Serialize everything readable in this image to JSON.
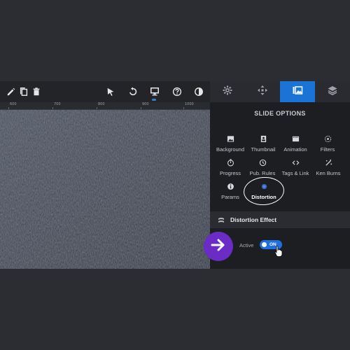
{
  "toolbar": {
    "icons": [
      "pencil-icon",
      "copy-icon",
      "trash-icon",
      "pointer-icon",
      "undo-icon",
      "desktop-icon",
      "help-icon",
      "contrast-icon"
    ]
  },
  "ruler": {
    "labels": [
      "600",
      "700",
      "800",
      "900",
      "1000"
    ]
  },
  "panel": {
    "tabs": [
      {
        "icon": "gear-icon",
        "active": false
      },
      {
        "icon": "move-icon",
        "active": false
      },
      {
        "icon": "image-gallery-icon",
        "active": true
      },
      {
        "icon": "layers-icon",
        "active": false
      }
    ],
    "section_title": "SLIDE OPTIONS",
    "options": [
      {
        "label": "Background",
        "icon": "image-icon"
      },
      {
        "label": "Thumbnail",
        "icon": "portrait-icon"
      },
      {
        "label": "Animation",
        "icon": "film-icon"
      },
      {
        "label": "Filters",
        "icon": "filter-icon"
      },
      {
        "label": "Progress",
        "icon": "timer-icon"
      },
      {
        "label": "Pub. Rules",
        "icon": "clock-icon"
      },
      {
        "label": "Tags & Link",
        "icon": "code-icon"
      },
      {
        "label": "Ken Burns",
        "icon": "magic-icon"
      },
      {
        "label": "Params",
        "icon": "info-icon"
      },
      {
        "label": "Distortion",
        "icon": "distortion-icon",
        "selected": true
      }
    ],
    "effect_header": "Distortion Effect",
    "active_label": "Active",
    "toggle_label": "ON"
  },
  "colors": {
    "accent": "#1c73d6",
    "badge": "#6a2cc5"
  }
}
